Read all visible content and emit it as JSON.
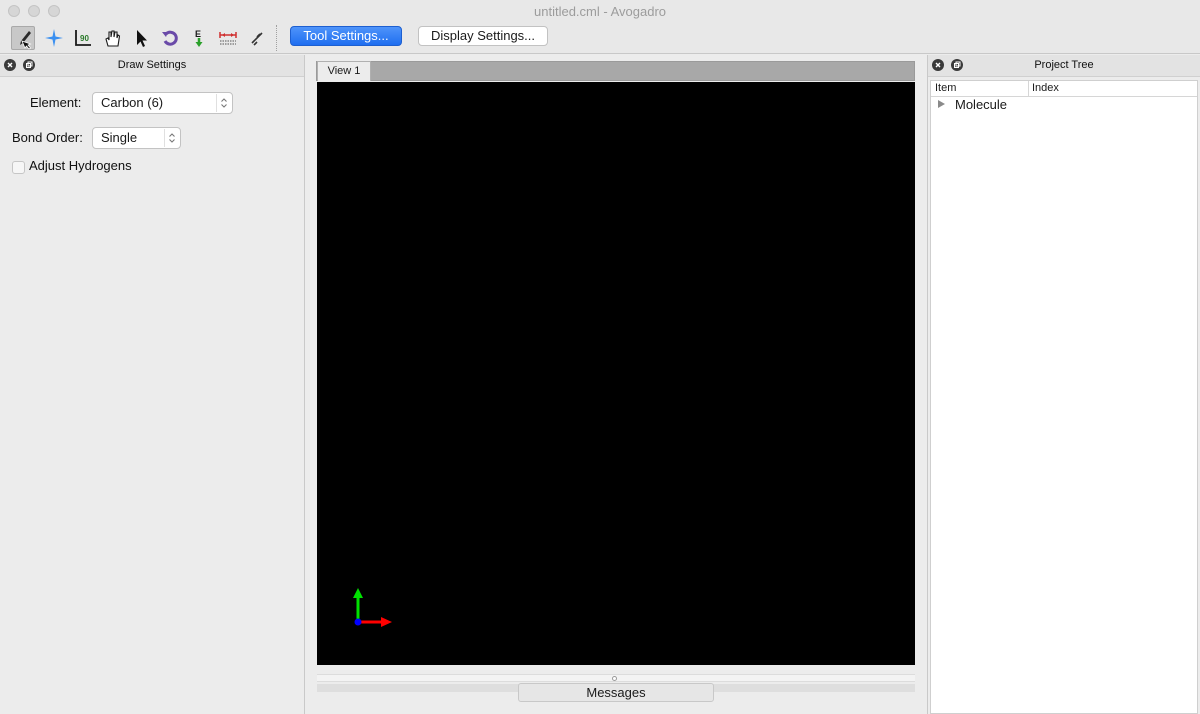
{
  "window": {
    "title": "untitled.cml - Avogadro"
  },
  "toolbar": {
    "tools": [
      {
        "icon": "draw-tool-icon",
        "active": true
      },
      {
        "icon": "navigate-tool-icon"
      },
      {
        "icon": "measure-tool-icon"
      },
      {
        "icon": "manipulate-tool-icon"
      },
      {
        "icon": "select-tool-icon"
      },
      {
        "icon": "autorotate-tool-icon"
      },
      {
        "icon": "autooptimize-tool-icon"
      },
      {
        "icon": "align-tool-icon"
      },
      {
        "icon": "bond-centric-tool-icon"
      }
    ],
    "tool_settings_label": "Tool Settings...",
    "display_settings_label": "Display Settings..."
  },
  "draw_settings": {
    "title": "Draw Settings",
    "element_label": "Element:",
    "element_value": "Carbon (6)",
    "bond_order_label": "Bond Order:",
    "bond_order_value": "Single",
    "adjust_hydrogens_label": "Adjust Hydrogens",
    "adjust_hydrogens_checked": false
  },
  "view": {
    "tab_label": "View 1",
    "background": "#000000",
    "axes_colors": {
      "x": "#ff0000",
      "y": "#00e000",
      "z": "#0000ff"
    }
  },
  "messages": {
    "label": "Messages"
  },
  "project_tree": {
    "title": "Project Tree",
    "columns": [
      "Item",
      "Index"
    ],
    "items": [
      {
        "label": "Molecule",
        "index": ""
      }
    ]
  },
  "colors": {
    "accent": "#2a78f5"
  }
}
